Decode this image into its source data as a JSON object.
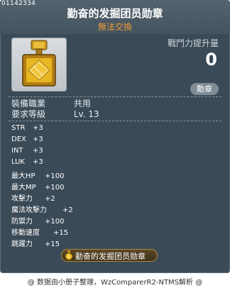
{
  "item": {
    "id": "01142334",
    "name": "勤奋的发掘团员勋章",
    "tradability": "無法交換",
    "power_label": "戰鬥力提升量",
    "power_value": "0",
    "category_badge": "勳章",
    "requirements": [
      {
        "label": "裝備職業",
        "value": "共用"
      },
      {
        "label": "要求等級",
        "value": "Lv. 13"
      }
    ],
    "stats": [
      {
        "name": "STR",
        "value": "+3"
      },
      {
        "name": "DEX",
        "value": "+3"
      },
      {
        "name": "INT",
        "value": "+3"
      },
      {
        "name": "LUK",
        "value": "+3"
      },
      {
        "name": "最大HP",
        "value": "+100"
      },
      {
        "name": "最大MP",
        "value": "+100"
      },
      {
        "name": "攻擊力",
        "value": "+2"
      },
      {
        "name": "魔法攻擊力",
        "value": "+2"
      },
      {
        "name": "防禦力",
        "value": "+100"
      },
      {
        "name": "移動速度",
        "value": "+15"
      },
      {
        "name": "跳躍力",
        "value": "+15"
      }
    ],
    "set_label": "勤奋的发掘团员勋章"
  },
  "footer": {
    "text": "@ 数据由小册子整理，WzComparerR2-NTMS解析 @"
  },
  "colors": {
    "panel": "#3a4a57",
    "tradability": "#f39a38",
    "medal_gold": "#e2b21c"
  },
  "icons": {
    "item_icon": "gold-medal-icon",
    "set_icon": "medal-icon"
  }
}
